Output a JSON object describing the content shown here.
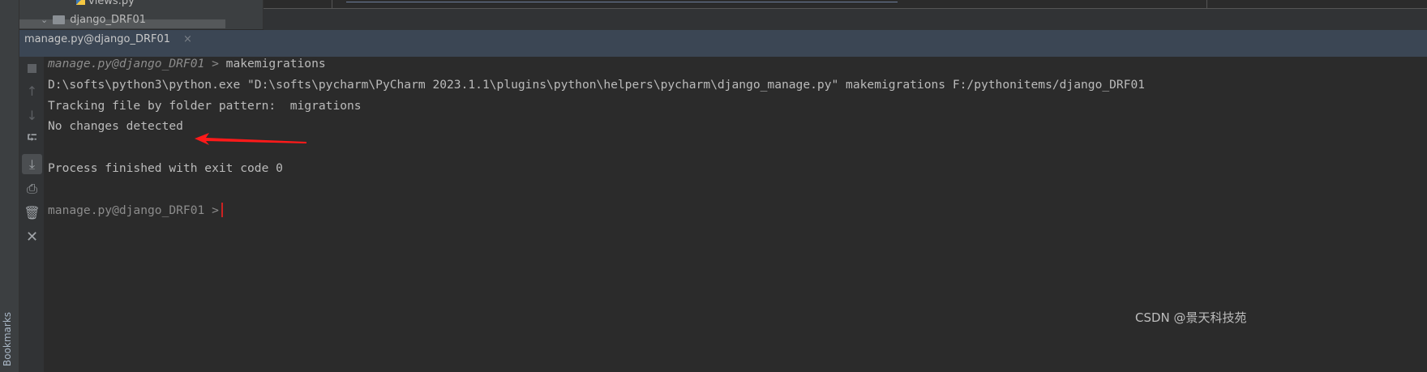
{
  "project_tree": {
    "file": "views.py",
    "folder": "django_DRF01"
  },
  "sidebar": {
    "bookmarks_label": "Bookmarks"
  },
  "run_tab": {
    "title": "manage.py@django_DRF01",
    "close": "×"
  },
  "toolbar": [
    "stop-icon",
    "up-arrow-icon",
    "down-arrow-icon",
    "soft-wrap-icon",
    "scroll-to-end-icon",
    "print-icon",
    "trash-icon",
    "close-icon"
  ],
  "console": {
    "prompt": "manage.py@django_DRF01 >",
    "command": " makemigrations",
    "lines": [
      "D:\\softs\\python3\\python.exe \"D:\\softs\\pycharm\\PyCharm 2023.1.1\\plugins\\python\\helpers\\pycharm\\django_manage.py\" makemigrations F:/pythonitems/django_DRF01",
      "Tracking file by folder pattern:  migrations",
      "No changes detected",
      "",
      "Process finished with exit code 0",
      ""
    ],
    "prompt2": "manage.py@django_DRF01 >"
  },
  "annotation_color": "#ff1a1a",
  "watermark": "CSDN @景天科技苑"
}
